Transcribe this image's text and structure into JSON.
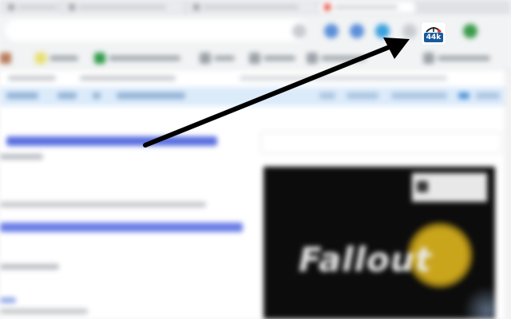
{
  "extension": {
    "badge_count": "44k",
    "badge_color": "#1a5a9c",
    "icon": "ublock-style-extension-icon"
  },
  "ad": {
    "title": "Fallout",
    "subtitle": ""
  },
  "colors": {
    "arrow": "#000000",
    "link_blue": "#3b5bdb",
    "subnav_blue": "#dcebfa"
  }
}
